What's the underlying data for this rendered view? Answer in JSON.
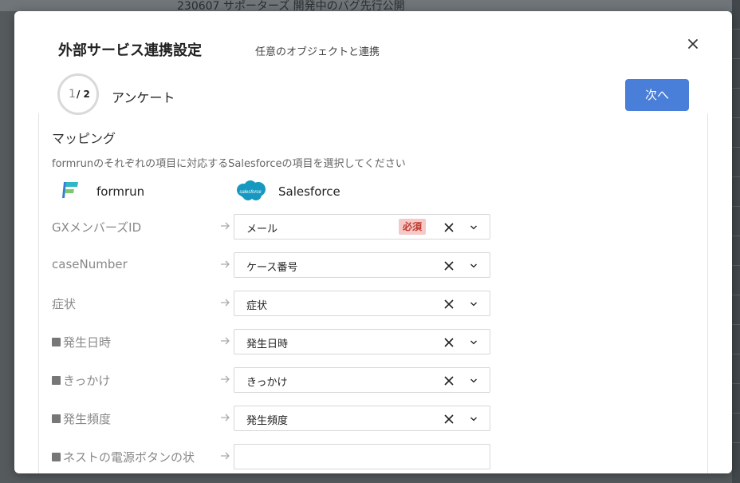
{
  "background": {
    "text": "230607 サポーターズ 開発中のバグ先行公開"
  },
  "modal": {
    "title": "外部サービス連携設定",
    "subtitle": "任意のオブジェクトと連携",
    "step": {
      "current": "1",
      "total": "/ 2",
      "label": "アンケート"
    },
    "next_label": "次へ"
  },
  "mapping": {
    "title": "マッピング",
    "description": "formrunのそれぞれの項目に対応するSalesforceの項目を選択してください",
    "source_name": "formrun",
    "destination_name": "Salesforce",
    "salesforce_logo_text": "salesforce",
    "required_badge": "必須",
    "rows": [
      {
        "label": "GXメンバーズID",
        "value": "メール",
        "required": true
      },
      {
        "label": "caseNumber",
        "value": "ケース番号"
      },
      {
        "label": "症状",
        "value": "症状"
      },
      {
        "label": "発生日時",
        "value": "発生日時",
        "square": true
      },
      {
        "label": "きっかけ",
        "value": "きっかけ",
        "square": true
      },
      {
        "label": "発生頻度",
        "value": "発生頻度",
        "square": true
      },
      {
        "label": "ネストの電源ボタンの状",
        "value": "",
        "square": true
      }
    ]
  },
  "colors": {
    "primary": "#4a7fd9",
    "required_bg": "#f6c9c9",
    "required_text": "#c0392b",
    "salesforce_blue": "#1798c1"
  },
  "icons": [
    "close-icon",
    "arrow-right-icon",
    "clear-icon",
    "chevron-down-icon",
    "formrun-logo-icon",
    "salesforce-logo-icon"
  ]
}
